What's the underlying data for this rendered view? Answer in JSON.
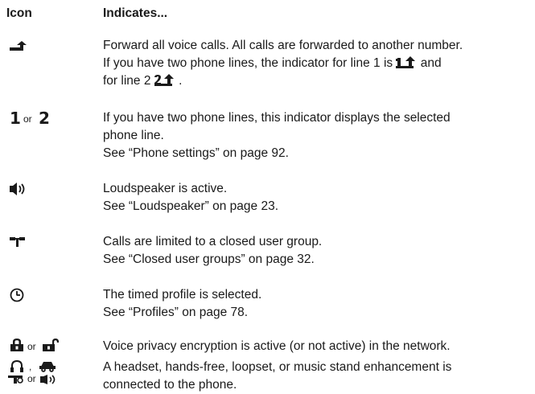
{
  "header": {
    "icon_col": "Icon",
    "indicates_col": "Indicates..."
  },
  "rows": [
    {
      "icon_names": [
        "call-forward-icon"
      ],
      "lines": [
        "Forward all voice calls. All calls are forwarded to another number.",
        "If you have two phone lines, the indicator for line 1 is",
        "and",
        "for line 2",
        "."
      ]
    },
    {
      "icon_names": [
        "line-1-icon",
        "line-2-icon"
      ],
      "or_text": "or",
      "icon_text_1": "1",
      "icon_text_2": "2",
      "lines": [
        "If you have two phone lines, this indicator displays the selected",
        "phone line.",
        "See “Phone settings” on page 92."
      ]
    },
    {
      "icon_names": [
        "loudspeaker-icon"
      ],
      "lines": [
        "Loudspeaker is active.",
        "See “Loudspeaker” on page 23."
      ]
    },
    {
      "icon_names": [
        "closed-user-group-icon"
      ],
      "lines": [
        "Calls are limited to a closed user group.",
        "See “Closed user groups” on page 32."
      ]
    },
    {
      "icon_names": [
        "timed-profile-clock-icon"
      ],
      "lines": [
        "The timed profile is selected.",
        "See “Profiles” on page 78."
      ]
    },
    {
      "icon_names": [
        "lock-closed-icon",
        "lock-open-icon"
      ],
      "or_text": "or",
      "lines": [
        "Voice privacy encryption is active (or not active) in the network."
      ]
    },
    {
      "icon_names": [
        "headset-icon",
        "hands-free-icon",
        "loopset-icon",
        "music-stand-icon"
      ],
      "sep_comma": ",",
      "or_text": "or",
      "lines": [
        "A headset, hands-free, loopset, or music stand enhancement is",
        "connected to the phone."
      ]
    }
  ]
}
